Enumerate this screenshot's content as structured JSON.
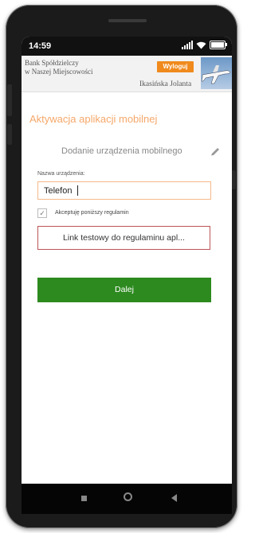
{
  "status_bar": {
    "time": "14:59"
  },
  "header": {
    "bank_name_line1": "Bank Spółdzielczy",
    "bank_name_line2": "w Naszej Miejscowości",
    "logout_label": "Wyloguj",
    "user_name": "Ikasińska Jolanta"
  },
  "page": {
    "title": "Aktywacja aplikacji mobilnej",
    "subtitle": "Dodanie urządzenia mobilnego"
  },
  "form": {
    "device_name_label": "Nazwa urządzenia:",
    "device_name_value": "Telefon",
    "accept_label": "Akceptuję poniższy regulamin",
    "accept_checked": true,
    "terms_link_label": "Link testowy do regulaminu apl...",
    "next_label": "Dalej"
  },
  "colors": {
    "accent_orange": "#f08a1c",
    "title_orange": "#f5a86a",
    "next_green": "#2d8a1f",
    "link_border": "#bb5555"
  },
  "icons": [
    "signal-icon",
    "wifi-icon",
    "battery-icon",
    "pencil-icon",
    "back-icon",
    "home-icon",
    "recent-apps-icon"
  ]
}
